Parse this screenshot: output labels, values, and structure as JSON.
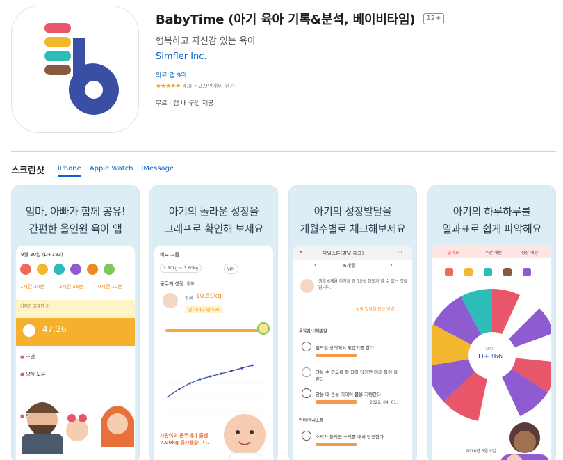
{
  "app": {
    "title": "BabyTime (아기 육아 기록&분석, 베이비타임)",
    "age_rating": "12+",
    "subtitle": "행복하고 자신감 있는 육아",
    "developer": "Simfler Inc.",
    "rank": "의료 앱 9위",
    "stars": "★★★★★",
    "rating": "4.8 • 2.9만개의 평가",
    "price": "무료 · 앱 내 구입 제공"
  },
  "screenshots": {
    "heading": "스크린샷",
    "tabs": [
      "iPhone",
      "Apple Watch",
      "iMessage"
    ],
    "active_tab": "iPhone",
    "cards": [
      {
        "caption_line1": "엄마, 아빠가 함께 공유!",
        "caption_line2": "간편한 올인원 육아 앱",
        "date": "9월 30일 (D+183)",
        "stats": [
          "1시간 30분",
          "2시간 26분",
          "0시간 10분"
        ],
        "notice": "기저귀 교체한 지",
        "timer": "47:26",
        "list": [
          "소변",
          "양쪽 모유",
          "분유"
        ]
      },
      {
        "caption_line1": "아기의 놀라운 성장을",
        "caption_line2": "그래프로 확인해 보세요",
        "group": "비교 그룹",
        "weight_range": "3.50kg ~ 3.60kg",
        "gender": "남아",
        "section": "몸무게 성장 비교",
        "current_label": "현재",
        "current_weight": "10.50kg",
        "message": "잘 자라고 있어요!",
        "bottom_text": "사랑이의 몸무게가 출생 7.00kg 증가했습니다."
      },
      {
        "caption_line1": "아기의 성장발달을",
        "caption_line2": "개월수별로 체크해보세요",
        "header": "마일스톤(발달 체크)",
        "month": "6개월",
        "description": "생후 6개월 아기들 중 75% 정도가 할 수 있는 것들입니다.",
        "link": "성장 발달을 돕는 방법",
        "category1": "움직임/신체발달",
        "items": [
          "엎드린 상태에서 뒤집기를 한다",
          "앉을 수 있도록 팔 잡아 당기면 머리 들어 올린다",
          "앉을 때 손을 기대어 몸을 지탱한다"
        ],
        "item_date": "2022. 04. 01.",
        "category2": "언어/의사소통",
        "item4": "소리가 들리면 소리를 내서 반응한다"
      },
      {
        "caption_line1": "아기의 하루하루를",
        "caption_line2": "일과표로 쉽게 파악해요",
        "tabs": [
          "일과표",
          "주간 패턴",
          "성장 패턴"
        ],
        "day_label": "DAY",
        "day_value": "D+366",
        "date": "2018년 6월 9일"
      }
    ]
  },
  "colors": {
    "accent": "#0a63c9",
    "icon_stripes": [
      "#e8566a",
      "#f3b72f",
      "#2dbcb7",
      "#8a5a3e"
    ],
    "icon_blue": "#3a4fa3",
    "orange": "#f5b12e"
  }
}
